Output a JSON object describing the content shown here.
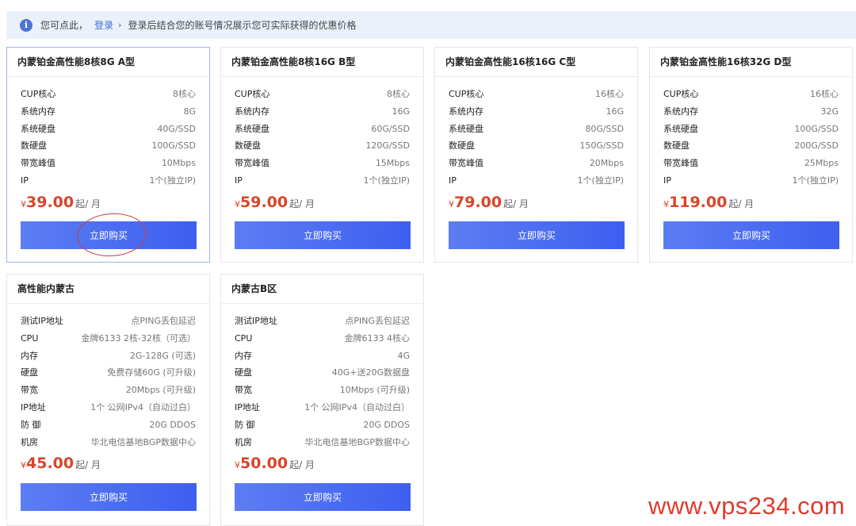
{
  "notice": {
    "icon": "info-icon",
    "text_before": "您可点此，",
    "login_link": "登录",
    "chevron": "›",
    "text_after": "登录后结合您的账号情况展示您可实际获得的优惠价格"
  },
  "currency_symbol": "¥",
  "price_unit": "起/ 月",
  "buy_label": "立即购买",
  "plans": [
    {
      "title": "内蒙铂金高性能8核8G A型",
      "specs": [
        {
          "label": "CUP核心",
          "value": "8核心"
        },
        {
          "label": "系统内存",
          "value": "8G"
        },
        {
          "label": "系统硬盘",
          "value": "40G/SSD"
        },
        {
          "label": "数硬盘",
          "value": "100G/SSD"
        },
        {
          "label": "带宽峰值",
          "value": "10Mbps"
        },
        {
          "label": "IP",
          "value": "1个(独立IP)"
        }
      ],
      "price": "39.00"
    },
    {
      "title": "内蒙铂金高性能8核16G B型",
      "specs": [
        {
          "label": "CUP核心",
          "value": "8核心"
        },
        {
          "label": "系统内存",
          "value": "16G"
        },
        {
          "label": "系统硬盘",
          "value": "60G/SSD"
        },
        {
          "label": "数硬盘",
          "value": "120G/SSD"
        },
        {
          "label": "带宽峰值",
          "value": "15Mbps"
        },
        {
          "label": "IP",
          "value": "1个(独立IP)"
        }
      ],
      "price": "59.00"
    },
    {
      "title": "内蒙铂金高性能16核16G C型",
      "specs": [
        {
          "label": "CUP核心",
          "value": "16核心"
        },
        {
          "label": "系统内存",
          "value": "16G"
        },
        {
          "label": "系统硬盘",
          "value": "80G/SSD"
        },
        {
          "label": "数硬盘",
          "value": "150G/SSD"
        },
        {
          "label": "带宽峰值",
          "value": "20Mbps"
        },
        {
          "label": "IP",
          "value": "1个(独立IP)"
        }
      ],
      "price": "79.00"
    },
    {
      "title": "内蒙铂金高性能16核32G D型",
      "specs": [
        {
          "label": "CUP核心",
          "value": "16核心"
        },
        {
          "label": "系统内存",
          "value": "32G"
        },
        {
          "label": "系统硬盘",
          "value": "100G/SSD"
        },
        {
          "label": "数硬盘",
          "value": "200G/SSD"
        },
        {
          "label": "带宽峰值",
          "value": "25Mbps"
        },
        {
          "label": "IP",
          "value": "1个(独立IP)"
        }
      ],
      "price": "119.00"
    },
    {
      "title": "高性能内蒙古",
      "specs": [
        {
          "label": "测试IP地址",
          "value": "点PING丢包延迟"
        },
        {
          "label": "CPU",
          "value": "金牌6133 2核-32核（可选）"
        },
        {
          "label": "内存",
          "value": "2G-128G (可选)"
        },
        {
          "label": "硬盘",
          "value": "免费存储60G (可升级)"
        },
        {
          "label": "带宽",
          "value": "20Mbps (可升级)"
        },
        {
          "label": "IP地址",
          "value": "1个 公网IPv4（自动过白）"
        },
        {
          "label": "防 御",
          "value": "20G DDOS"
        },
        {
          "label": "机房",
          "value": "华北电信基地BGP数据中心"
        }
      ],
      "price": "45.00"
    },
    {
      "title": "内蒙古B区",
      "specs": [
        {
          "label": "测试IP地址",
          "value": "点PING丢包延迟"
        },
        {
          "label": "CPU",
          "value": "金牌6133 4核心"
        },
        {
          "label": "内存",
          "value": "4G"
        },
        {
          "label": "硬盘",
          "value": "40G+送20G数据盘"
        },
        {
          "label": "带宽",
          "value": "10Mbps (可升级)"
        },
        {
          "label": "IP地址",
          "value": "1个 公网IPv4（自动过白）"
        },
        {
          "label": "防 御",
          "value": "20G DDOS"
        },
        {
          "label": "机房",
          "value": "华北电信基地BGP数据中心"
        }
      ],
      "price": "50.00"
    }
  ],
  "watermark": "www.vps234.com",
  "colors": {
    "accent": "#4a6af0",
    "price": "#d8452a",
    "notice_bg": "#ebf1fb",
    "annotation": "#d23a3a"
  }
}
